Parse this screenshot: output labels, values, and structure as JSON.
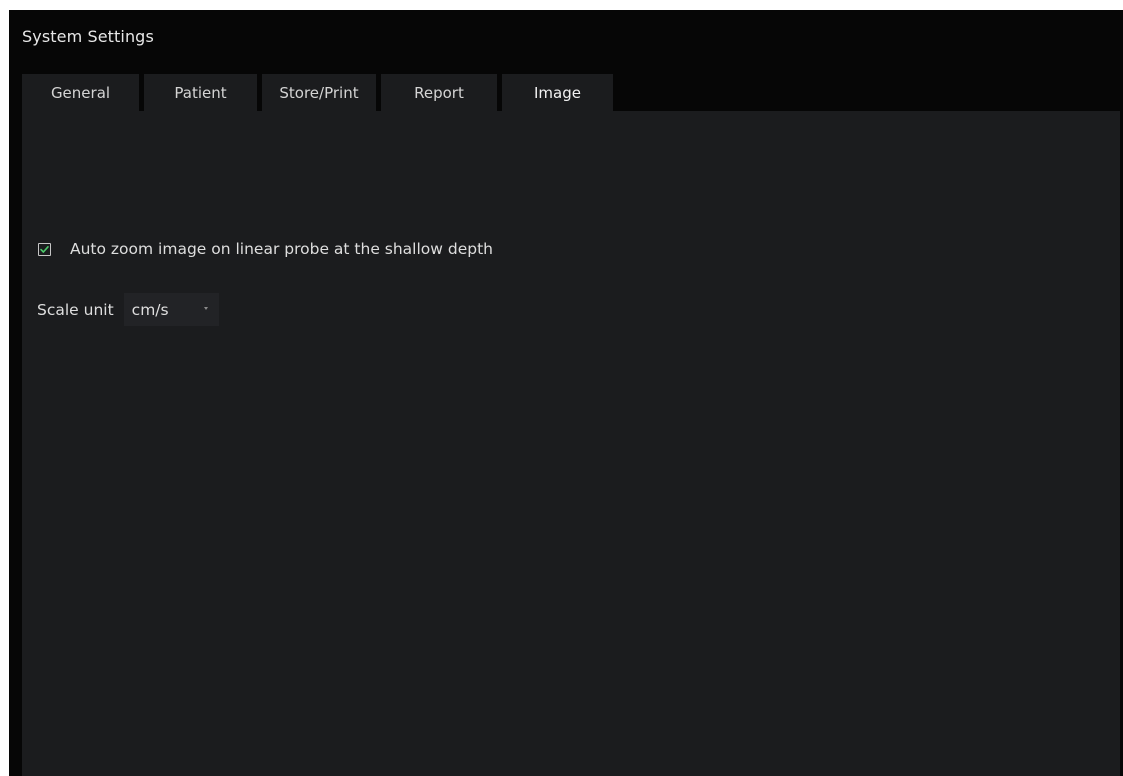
{
  "window": {
    "title": "System Settings"
  },
  "tabs": [
    {
      "label": "General",
      "active": false
    },
    {
      "label": "Patient",
      "active": false
    },
    {
      "label": "Store/Print",
      "active": false
    },
    {
      "label": "Report",
      "active": false
    },
    {
      "label": "Image",
      "active": true
    }
  ],
  "image_settings": {
    "auto_zoom": {
      "label": "Auto zoom image on linear probe at the shallow depth",
      "checked": true
    },
    "scale_unit": {
      "label": "Scale unit",
      "value": "cm/s",
      "icon": "chevron-down-icon"
    }
  },
  "colors": {
    "background": "#060606",
    "panel": "#1b1c1e",
    "check_accent": "#4cc96a",
    "text": "#dedede"
  }
}
